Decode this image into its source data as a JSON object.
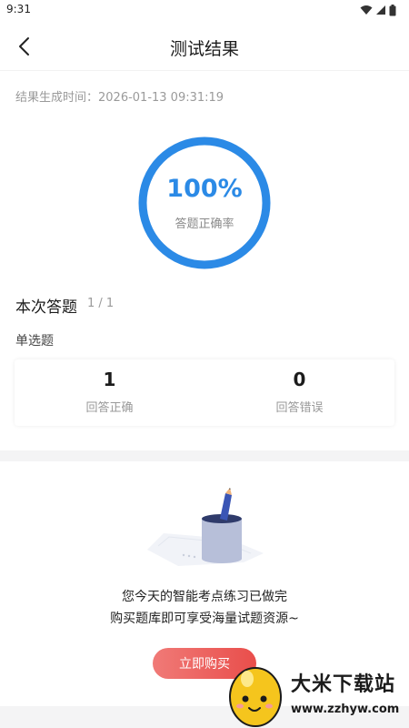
{
  "status_bar": {
    "time": "9:31"
  },
  "header": {
    "title": "测试结果"
  },
  "result": {
    "generated_time": "结果生成时间：2026-01-13 09:31:19",
    "accuracy_percent": "100%",
    "accuracy_value": 1.0,
    "accuracy_label": "答题正确率"
  },
  "section": {
    "title": "本次答题",
    "count": "1 / 1",
    "question_type": "单选题"
  },
  "stats": {
    "correct_value": "1",
    "correct_label": "回答正确",
    "wrong_value": "0",
    "wrong_label": "回答错误"
  },
  "completion": {
    "line1": "您今天的智能考点练习已做完",
    "line2": "购买题库即可享受海量试题资源~",
    "buy_button": "立即购买"
  },
  "watermark": {
    "text": "大米下载站",
    "url": "www.zzhyw.com"
  },
  "colors": {
    "accent": "#2b8ae6",
    "button": "#e94e4b"
  },
  "icons": {
    "back": "chevron-left-icon",
    "wifi": "wifi-icon",
    "signal": "signal-icon",
    "battery": "battery-icon"
  }
}
